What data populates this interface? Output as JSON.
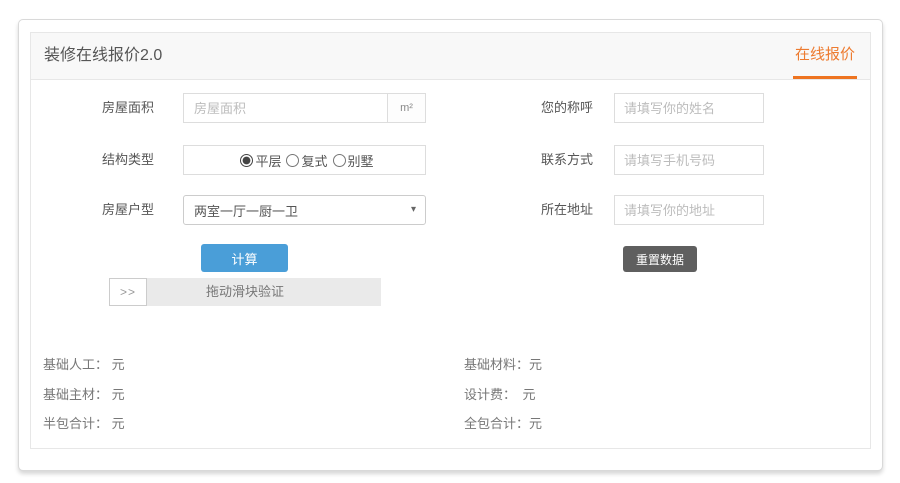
{
  "header": {
    "title": "装修在线报价2.0",
    "tab": "在线报价"
  },
  "form": {
    "area": {
      "label": "房屋面积",
      "placeholder": "房屋面积",
      "unit": "m²"
    },
    "name": {
      "label": "您的称呼",
      "placeholder": "请填写你的姓名"
    },
    "structure": {
      "label": "结构类型",
      "options": [
        "平层",
        "复式",
        "别墅"
      ],
      "selected_index": 0
    },
    "contact": {
      "label": "联系方式",
      "placeholder": "请填写手机号码"
    },
    "house_type": {
      "label": "房屋户型",
      "value": "两室一厅一厨一卫",
      "caret_icon": "▾"
    },
    "address": {
      "label": "所在地址",
      "placeholder": "请填写你的地址"
    },
    "calc_button": "计算",
    "reset_button": "重置数据",
    "slider": {
      "handle_icon": ">>",
      "text": "拖动滑块验证"
    }
  },
  "results": {
    "left": [
      "基础人工： 元",
      "基础主材： 元",
      "半包合计： 元"
    ],
    "right": [
      "基础材料：元",
      "设计费：　元",
      "全包合计：元"
    ]
  },
  "colors": {
    "accent_orange": "#ee7420",
    "calc_button_blue": "#4a9ed8",
    "reset_button_gray": "#5f5f5f"
  }
}
